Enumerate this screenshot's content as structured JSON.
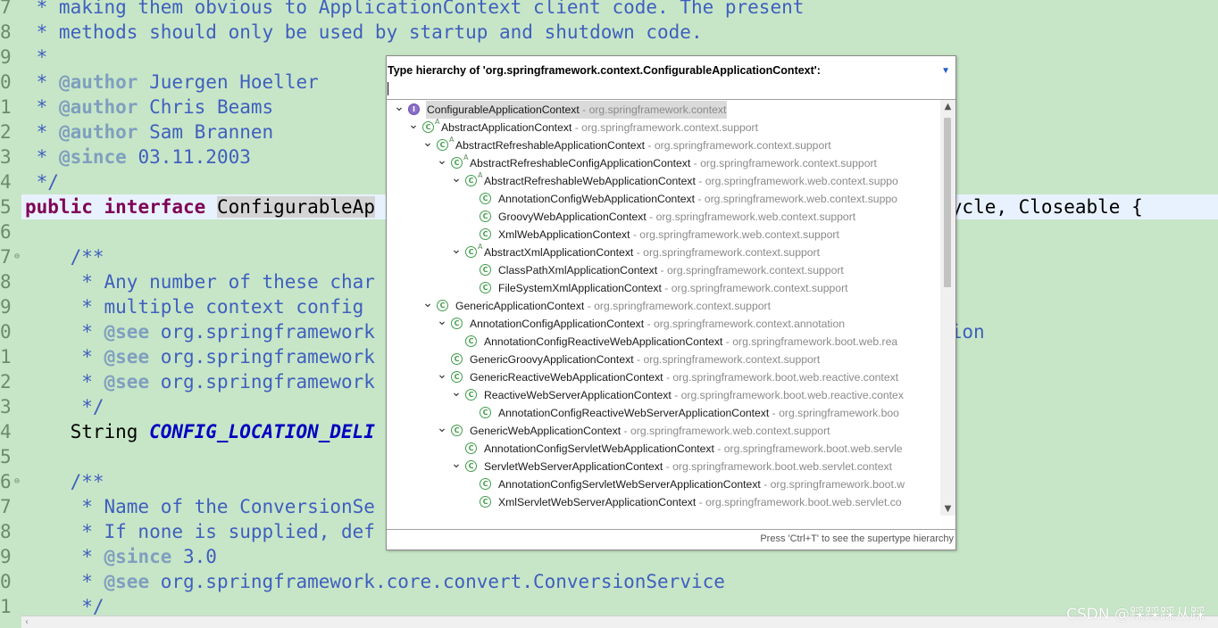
{
  "editor": {
    "line_numbers": [
      "7",
      "8",
      "9",
      "0",
      "1",
      "2",
      "3",
      "4",
      "5",
      "6",
      "7",
      "8",
      "9",
      "0",
      "1",
      "2",
      "3",
      "4",
      "5",
      "6",
      "7",
      "8",
      "9",
      "0",
      "1"
    ],
    "fold_markers": {
      "17": "⊖",
      "26": "⊖"
    },
    "lines": [
      [
        {
          "t": " * making them obvious to ApplicationContext client code. The present",
          "c": "cmt"
        }
      ],
      [
        {
          "t": " * methods should only be used by startup and shutdown code.",
          "c": "cmt"
        }
      ],
      [
        {
          "t": " *",
          "c": "cmt"
        }
      ],
      [
        {
          "t": " * ",
          "c": "cmt"
        },
        {
          "t": "@author",
          "c": "tag"
        },
        {
          "t": " Juergen Hoeller",
          "c": "cmt"
        }
      ],
      [
        {
          "t": " * ",
          "c": "cmt"
        },
        {
          "t": "@author",
          "c": "tag"
        },
        {
          "t": " Chris Beams",
          "c": "cmt"
        }
      ],
      [
        {
          "t": " * ",
          "c": "cmt"
        },
        {
          "t": "@author",
          "c": "tag"
        },
        {
          "t": " Sam Brannen",
          "c": "cmt"
        }
      ],
      [
        {
          "t": " * ",
          "c": "cmt"
        },
        {
          "t": "@since",
          "c": "tag"
        },
        {
          "t": " 03.11.2003",
          "c": "cmt"
        }
      ],
      [
        {
          "t": " */",
          "c": "cmt"
        }
      ],
      [
        {
          "t": "public",
          "c": "kw"
        },
        {
          "t": " "
        },
        {
          "t": "interface",
          "c": "kw"
        },
        {
          "t": " "
        },
        {
          "t": "ConfigurableAp",
          "c": "sel"
        },
        {
          "t": "                                                  cycle, Closeable {"
        }
      ],
      [
        {
          "t": ""
        }
      ],
      [
        {
          "t": "    /**",
          "c": "cmt"
        }
      ],
      [
        {
          "t": "     * Any number of these char",
          "c": "cmt"
        }
      ],
      [
        {
          "t": "     * multiple context config ",
          "c": "cmt"
        }
      ],
      [
        {
          "t": "     * ",
          "c": "cmt"
        },
        {
          "t": "@see",
          "c": "tag"
        },
        {
          "t": " org.springframework                                       tConfigLocation",
          "c": "cmt"
        }
      ],
      [
        {
          "t": "     * ",
          "c": "cmt"
        },
        {
          "t": "@see",
          "c": "tag"
        },
        {
          "t": " org.springframework",
          "c": "cmt"
        }
      ],
      [
        {
          "t": "     * ",
          "c": "cmt"
        },
        {
          "t": "@see",
          "c": "tag"
        },
        {
          "t": " org.springframework                                       ation",
          "c": "cmt"
        }
      ],
      [
        {
          "t": "     */",
          "c": "cmt"
        }
      ],
      [
        {
          "t": "    String "
        },
        {
          "t": "CONFIG_LOCATION_DELI",
          "c": "const"
        }
      ],
      [
        {
          "t": ""
        }
      ],
      [
        {
          "t": "    /**",
          "c": "cmt"
        }
      ],
      [
        {
          "t": "     * Name of the ConversionSe",
          "c": "cmt"
        }
      ],
      [
        {
          "t": "     * If none is supplied, def",
          "c": "cmt"
        }
      ],
      [
        {
          "t": "     * ",
          "c": "cmt"
        },
        {
          "t": "@since",
          "c": "tag"
        },
        {
          "t": " 3.0",
          "c": "cmt"
        }
      ],
      [
        {
          "t": "     * ",
          "c": "cmt"
        },
        {
          "t": "@see",
          "c": "tag"
        },
        {
          "t": " org.springframework.core.convert.ConversionService",
          "c": "cmt"
        }
      ],
      [
        {
          "t": "     */",
          "c": "cmt"
        }
      ]
    ]
  },
  "watermark": "CSDN @踩踩踩从踩",
  "popup": {
    "title": "Type hierarchy of 'org.springframework.context.ConfigurableApplicationContext':",
    "menu_icon": "chevron-down-icon",
    "filter_value": "",
    "footer": "Press 'Ctrl+T' to see the supertype hierarchy",
    "tree": [
      {
        "d": 0,
        "exp": "open",
        "icon": "interface",
        "name": "ConfigurableApplicationContext",
        "pkg": "org.springframework.context",
        "selected": true
      },
      {
        "d": 1,
        "exp": "open",
        "icon": "class",
        "ovl": "A",
        "name": "AbstractApplicationContext",
        "pkg": "org.springframework.context.support"
      },
      {
        "d": 2,
        "exp": "open",
        "icon": "class",
        "ovl": "A",
        "name": "AbstractRefreshableApplicationContext",
        "pkg": "org.springframework.context.support"
      },
      {
        "d": 3,
        "exp": "open",
        "icon": "class",
        "ovl": "A",
        "name": "AbstractRefreshableConfigApplicationContext",
        "pkg": "org.springframework.context.support"
      },
      {
        "d": 4,
        "exp": "open",
        "icon": "class",
        "ovl": "A",
        "name": "AbstractRefreshableWebApplicationContext",
        "pkg": "org.springframework.web.context.suppo"
      },
      {
        "d": 5,
        "exp": "none",
        "icon": "class",
        "name": "AnnotationConfigWebApplicationContext",
        "pkg": "org.springframework.web.context.suppo"
      },
      {
        "d": 5,
        "exp": "none",
        "icon": "class",
        "name": "GroovyWebApplicationContext",
        "pkg": "org.springframework.web.context.support"
      },
      {
        "d": 5,
        "exp": "none",
        "icon": "class",
        "name": "XmlWebApplicationContext",
        "pkg": "org.springframework.web.context.support"
      },
      {
        "d": 4,
        "exp": "open",
        "icon": "class",
        "ovl": "A",
        "name": "AbstractXmlApplicationContext",
        "pkg": "org.springframework.context.support"
      },
      {
        "d": 5,
        "exp": "none",
        "icon": "class",
        "name": "ClassPathXmlApplicationContext",
        "pkg": "org.springframework.context.support"
      },
      {
        "d": 5,
        "exp": "none",
        "icon": "class",
        "name": "FileSystemXmlApplicationContext",
        "pkg": "org.springframework.context.support"
      },
      {
        "d": 2,
        "exp": "open",
        "icon": "class",
        "name": "GenericApplicationContext",
        "pkg": "org.springframework.context.support"
      },
      {
        "d": 3,
        "exp": "open",
        "icon": "class",
        "name": "AnnotationConfigApplicationContext",
        "pkg": "org.springframework.context.annotation"
      },
      {
        "d": 4,
        "exp": "none",
        "icon": "class",
        "name": "AnnotationConfigReactiveWebApplicationContext",
        "pkg": "org.springframework.boot.web.rea"
      },
      {
        "d": 3,
        "exp": "none",
        "icon": "class",
        "name": "GenericGroovyApplicationContext",
        "pkg": "org.springframework.context.support"
      },
      {
        "d": 3,
        "exp": "open",
        "icon": "class",
        "name": "GenericReactiveWebApplicationContext",
        "pkg": "org.springframework.boot.web.reactive.context"
      },
      {
        "d": 4,
        "exp": "open",
        "icon": "class",
        "name": "ReactiveWebServerApplicationContext",
        "pkg": "org.springframework.boot.web.reactive.contex"
      },
      {
        "d": 5,
        "exp": "none",
        "icon": "class",
        "name": "AnnotationConfigReactiveWebServerApplicationContext",
        "pkg": "org.springframework.boo"
      },
      {
        "d": 3,
        "exp": "open",
        "icon": "class",
        "name": "GenericWebApplicationContext",
        "pkg": "org.springframework.web.context.support"
      },
      {
        "d": 4,
        "exp": "none",
        "icon": "class",
        "name": "AnnotationConfigServletWebApplicationContext",
        "pkg": "org.springframework.boot.web.servle"
      },
      {
        "d": 4,
        "exp": "open",
        "icon": "class",
        "name": "ServletWebServerApplicationContext",
        "pkg": "org.springframework.boot.web.servlet.context"
      },
      {
        "d": 5,
        "exp": "none",
        "icon": "class",
        "name": "AnnotationConfigServletWebServerApplicationContext",
        "pkg": "org.springframework.boot.w"
      },
      {
        "d": 5,
        "exp": "none",
        "icon": "class",
        "name": "XmlServletWebServerApplicationContext",
        "pkg": "org.springframework.boot.web.servlet.co"
      }
    ]
  }
}
